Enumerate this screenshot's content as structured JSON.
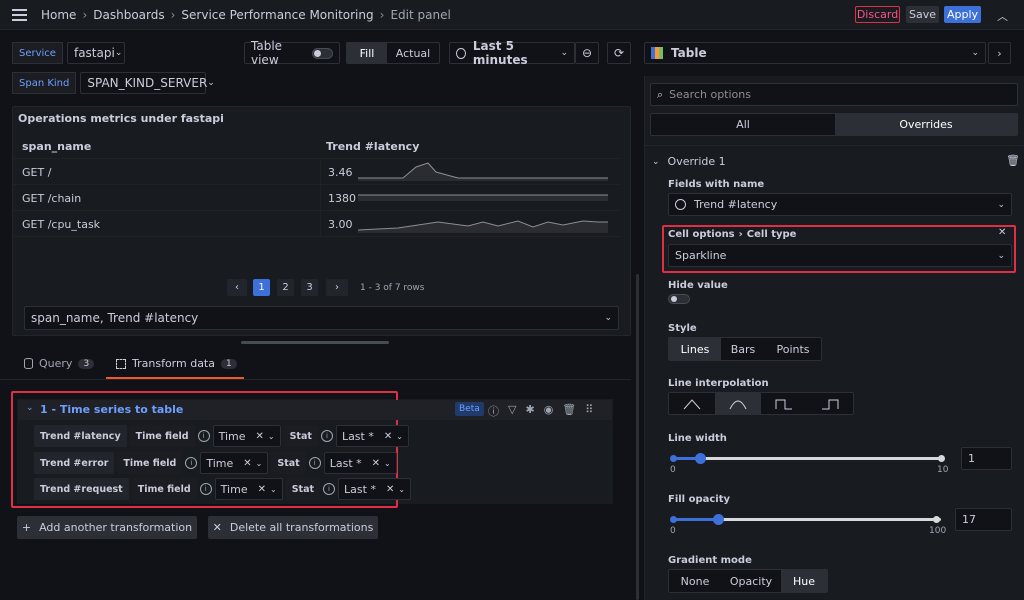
{
  "topbar": {
    "breadcrumbs": [
      "Home",
      "Dashboards",
      "Service Performance Monitoring",
      "Edit panel"
    ],
    "discard": "Discard",
    "save": "Save",
    "apply": "Apply"
  },
  "vars": {
    "service_label": "Service",
    "service_value": "fastapi",
    "span_kind_label": "Span Kind",
    "span_kind_value": "SPAN_KIND_SERVER"
  },
  "toolbar": {
    "table_view": "Table view",
    "fill": "Fill",
    "actual": "Actual",
    "time_range": "Last 5 minutes"
  },
  "panel": {
    "title": "Operations metrics under fastapi",
    "columns": [
      "span_name",
      "Trend #latency"
    ],
    "rows": [
      {
        "name": "GET /",
        "value": "3.46"
      },
      {
        "name": "GET /chain",
        "value": "1380"
      },
      {
        "name": "GET /cpu_task",
        "value": "3.00"
      }
    ],
    "pages": [
      "1",
      "2",
      "3"
    ],
    "prev": "‹",
    "next": "›",
    "rows_info": "1 - 3 of 7 rows",
    "footer_select": "span_name, Trend #latency"
  },
  "tabs": [
    {
      "label": "Query",
      "count": "3"
    },
    {
      "label": "Transform data",
      "count": "1"
    }
  ],
  "transform": {
    "title": "1 - Time series to table",
    "beta": "Beta",
    "time_field_label": "Time field",
    "stat_label": "Stat",
    "rows": [
      {
        "name": "Trend #latency",
        "time": "Time",
        "stat": "Last *"
      },
      {
        "name": "Trend #error",
        "time": "Time",
        "stat": "Last *"
      },
      {
        "name": "Trend #request",
        "time": "Time",
        "stat": "Last *"
      }
    ],
    "add": "Add another transformation",
    "delete": "Delete all transformations"
  },
  "options": {
    "viz": "Table",
    "search_placeholder": "Search options",
    "tab_all": "All",
    "tab_overrides": "Overrides",
    "override_title": "Override 1",
    "fields_label": "Fields with name",
    "fields_value": "Trend #latency",
    "cell_options": "Cell options",
    "cell_type": "Cell type",
    "cell_type_value": "Sparkline",
    "hide_value": "Hide value",
    "style_label": "Style",
    "style_opts": [
      "Lines",
      "Bars",
      "Points"
    ],
    "interp_label": "Line interpolation",
    "line_width_label": "Line width",
    "line_width_min": "0",
    "line_width_max": "10",
    "line_width_value": "1",
    "fill_label": "Fill opacity",
    "fill_min": "0",
    "fill_max": "100",
    "fill_value": "17",
    "gradient_label": "Gradient mode",
    "gradient_opts": [
      "None",
      "Opacity",
      "Hue"
    ]
  },
  "colors": {
    "accent": "#3d71d9",
    "highlight": "#e02f44",
    "tab_underline": "#f05a28"
  }
}
